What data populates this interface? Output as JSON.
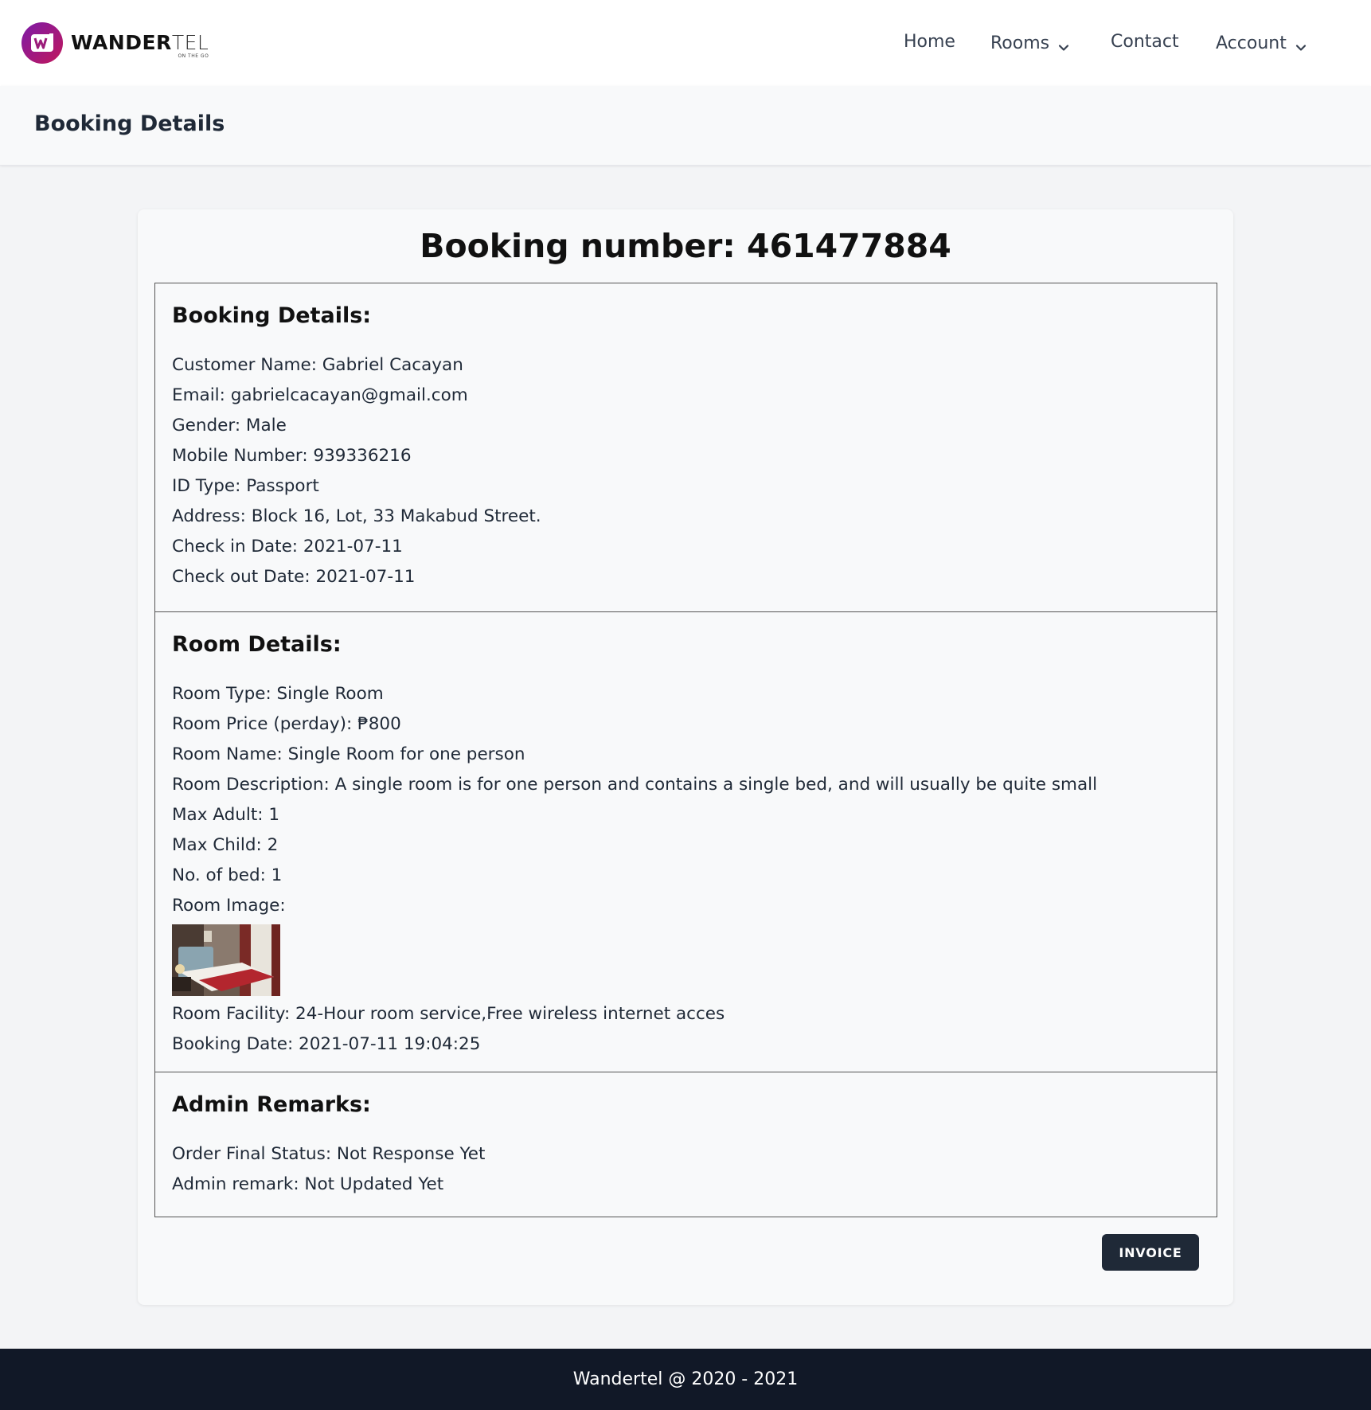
{
  "brand": {
    "name_bold": "WANDER",
    "name_light": "TEL",
    "tagline": "ON THE GO",
    "logo_letter": "W"
  },
  "nav": {
    "home": "Home",
    "rooms": "Rooms",
    "contact": "Contact",
    "account": "Account"
  },
  "page_header": {
    "title": "Booking Details"
  },
  "booking": {
    "title": "Booking number: 461477884",
    "details": {
      "heading": "Booking Details:",
      "customer_name": "Customer Name: Gabriel Cacayan",
      "email": "Email: gabrielcacayan@gmail.com",
      "gender": "Gender: Male",
      "mobile": "Mobile Number: 939336216",
      "id_type": "ID Type: Passport",
      "address": "Address: Block 16, Lot, 33 Makabud Street.",
      "check_in": "Check in Date: 2021-07-11",
      "check_out": "Check out Date: 2021-07-11"
    },
    "room": {
      "heading": "Room Details:",
      "type": "Room Type: Single Room",
      "price": "Room Price (perday): ₱800",
      "name": "Room Name: Single Room for one person",
      "description": "Room Description: A single room is for one person and contains a single bed, and will usually be quite small",
      "max_adult": "Max Adult: 1",
      "max_child": "Max Child: 2",
      "beds": "No. of bed: 1",
      "image_label": "Room Image:",
      "facility": "Room Facility: 24-Hour room service,Free wireless internet acces",
      "booking_date": "Booking Date: 2021-07-11 19:04:25"
    },
    "admin": {
      "heading": "Admin Remarks:",
      "status": "Order Final Status: Not Response Yet",
      "remark": "Admin remark: Not Updated Yet"
    },
    "invoice_label": "INVOICE"
  },
  "footer": {
    "text": "Wandertel @ 2020 - 2021"
  },
  "colors": {
    "brand_gradient_start": "#7c1aa8",
    "brand_gradient_end": "#c1185b",
    "footer_bg": "#111827",
    "button_bg": "#1f2937"
  },
  "icons": {
    "logo": "wandertel-logo-icon",
    "dropdown": "chevron-down-icon"
  }
}
